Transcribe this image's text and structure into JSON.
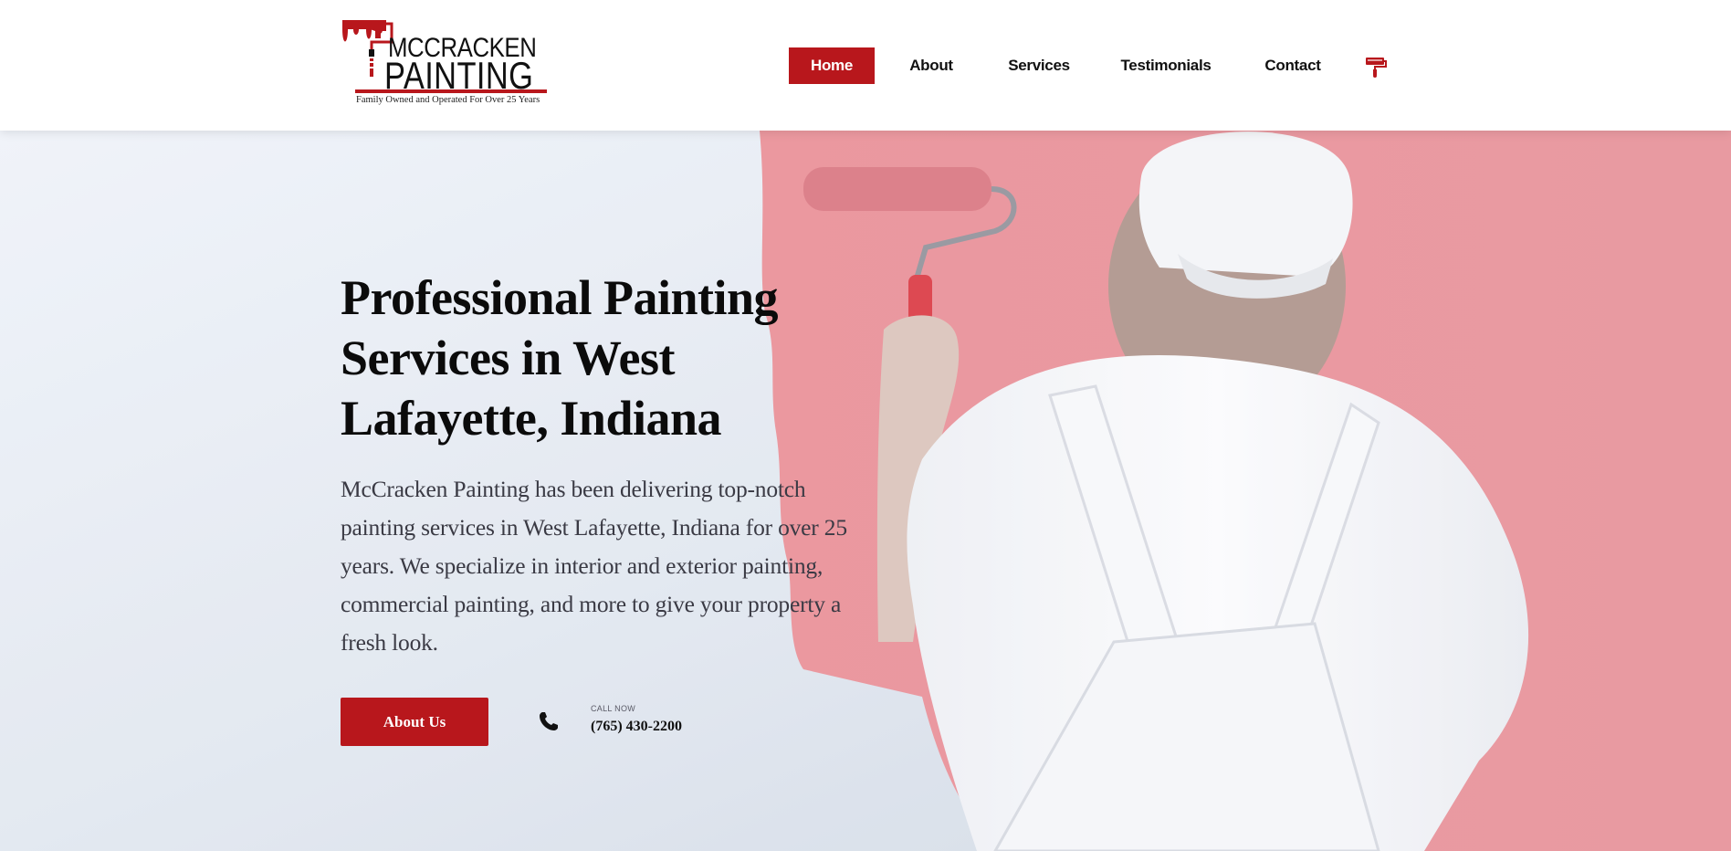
{
  "brand": {
    "name_line1": "MCCRACKEN",
    "name_line2": "PAINTING",
    "tagline": "Family Owned and Operated For Over 25 Years",
    "accent_color": "#b8171c",
    "logo_icon": "paint-roller-icon"
  },
  "nav": {
    "items": [
      {
        "label": "Home",
        "active": true
      },
      {
        "label": "About",
        "active": false
      },
      {
        "label": "Services",
        "active": false
      },
      {
        "label": "Testimonials",
        "active": false
      },
      {
        "label": "Contact",
        "active": false
      }
    ],
    "cart_icon": "paint-roller-cart-icon"
  },
  "hero": {
    "title": "Professional Painting Services in West Lafayette, Indiana",
    "description": "McCracken Painting has been delivering top-notch painting services in West Lafayette, Indiana for over 25 years. We specialize in interior and exterior painting, commercial painting, and more to give your property a fresh look.",
    "cta_label": "About Us",
    "call_label": "CALL NOW",
    "phone": "(765) 430-2200",
    "phone_icon": "phone-icon",
    "background_image": "painter-rolling-red-wall"
  }
}
